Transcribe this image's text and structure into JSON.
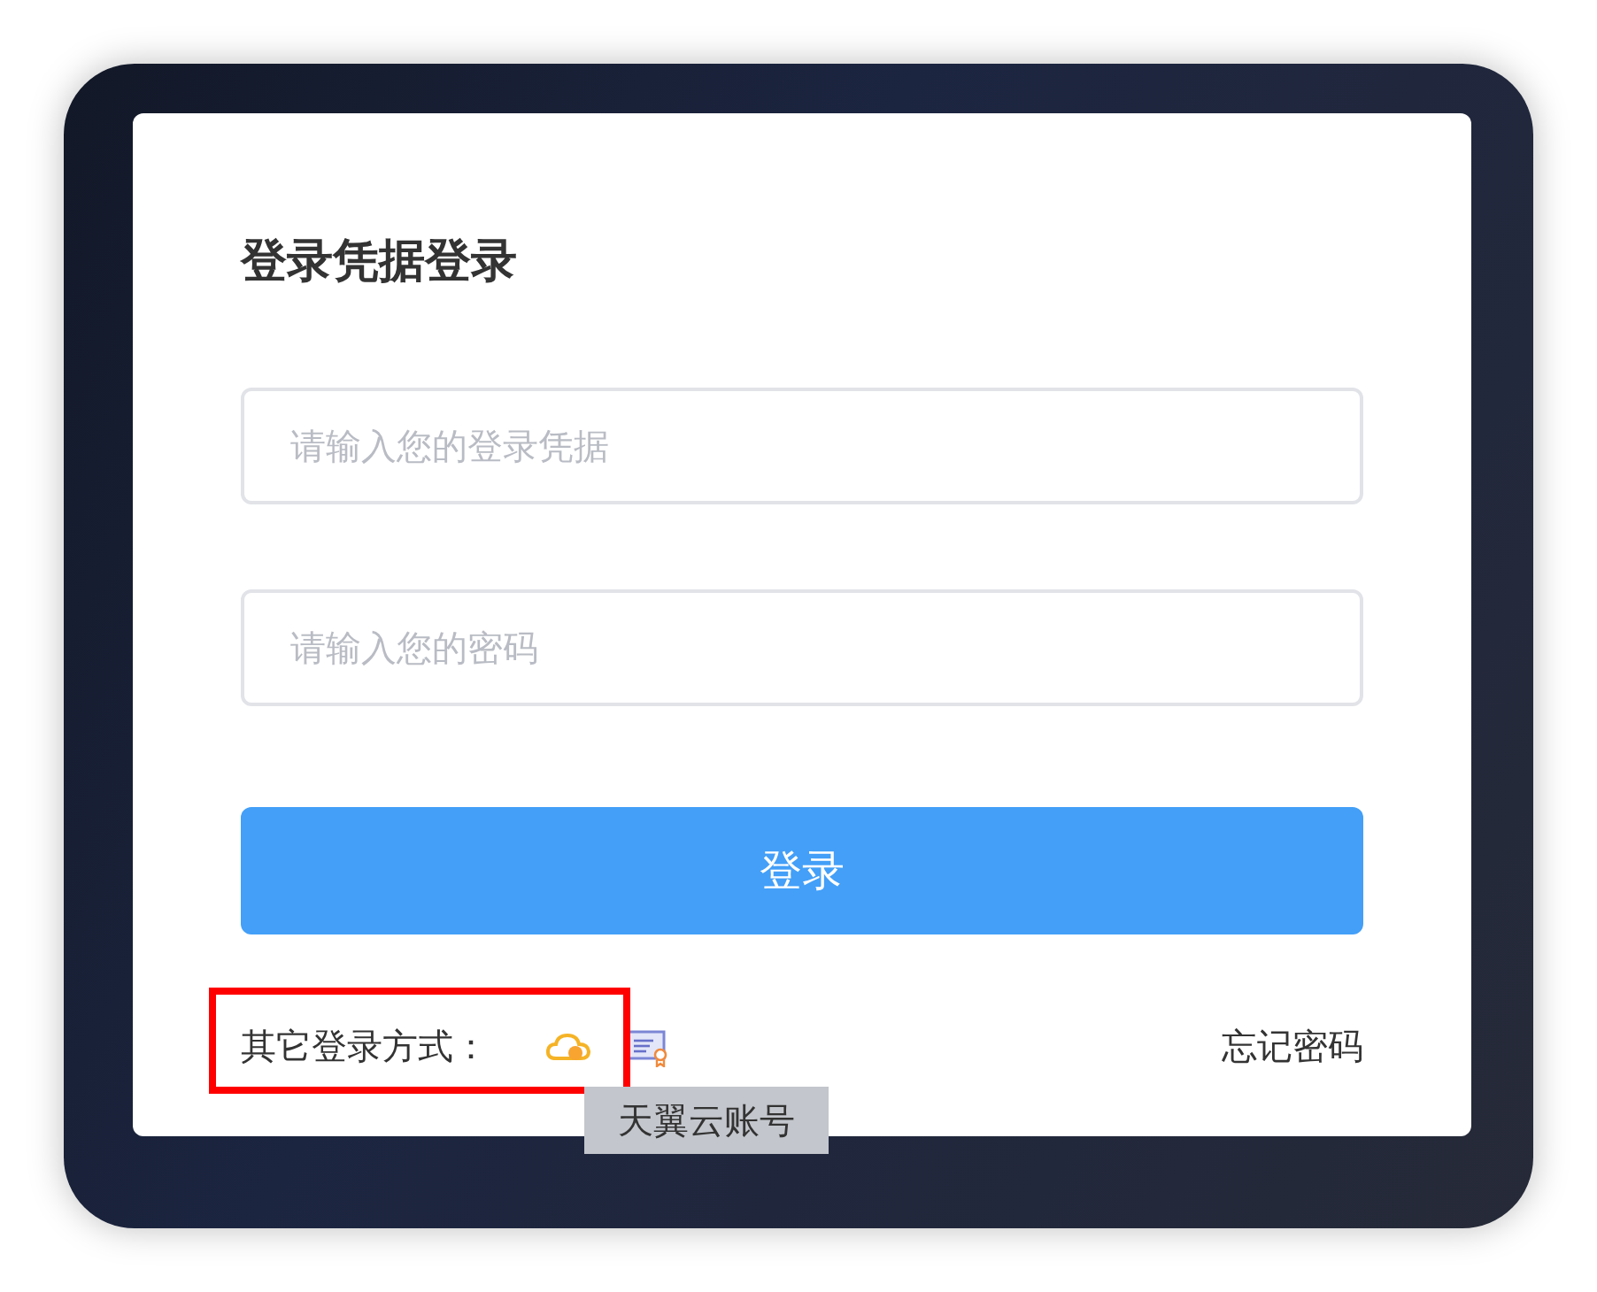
{
  "title": "登录凭据登录",
  "fields": [
    {
      "placeholder": "请输入您的登录凭据"
    },
    {
      "placeholder": "请输入您的密码"
    }
  ],
  "login_button": "登录",
  "other_methods": {
    "label": "其它登录方式：",
    "highlighted": true,
    "options": [
      {
        "kind": "cloud"
      },
      {
        "kind": "certificate"
      }
    ]
  },
  "forgot_link": "忘记密码",
  "tooltip": "天翼云账号"
}
